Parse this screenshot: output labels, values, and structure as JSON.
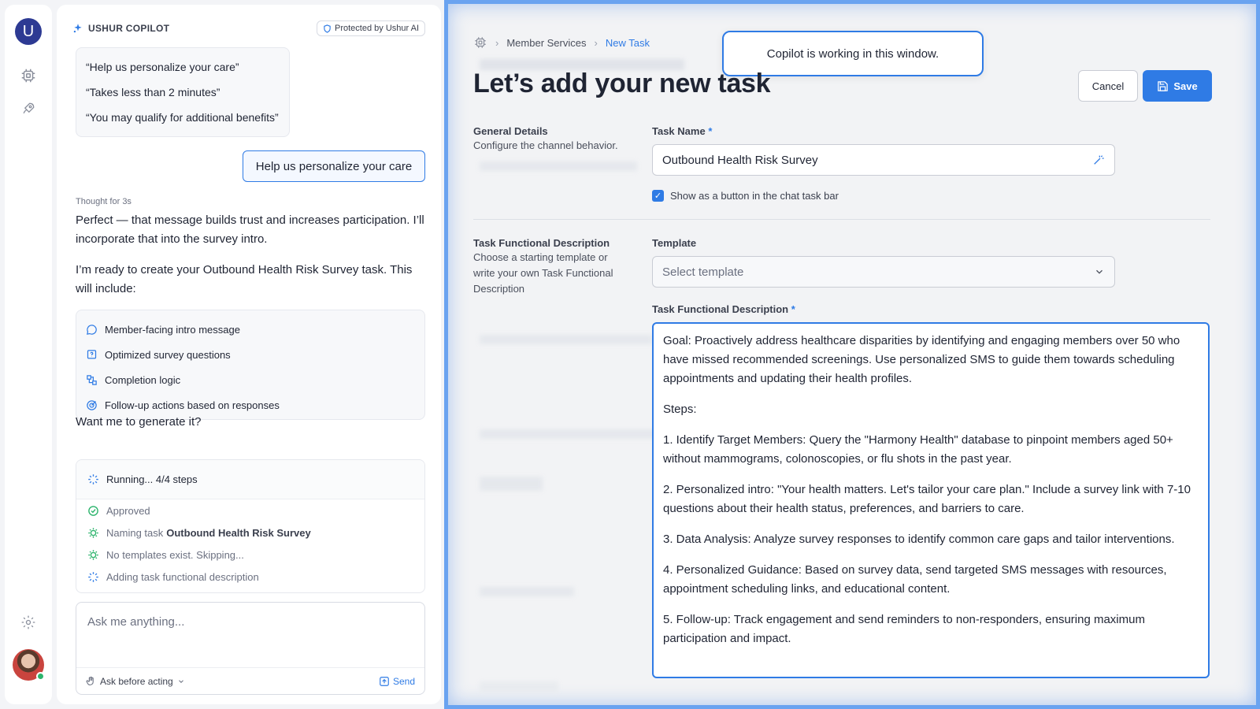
{
  "rail": {
    "logo_letter": "U",
    "items": [
      {
        "icon": "chip-icon"
      },
      {
        "icon": "rocket-icon"
      },
      {
        "icon": "gear-icon"
      }
    ]
  },
  "copilot": {
    "title": "USHUR COPILOT",
    "protected_label": "Protected by Ushur AI",
    "suggestions": [
      "“Help us personalize your care”",
      "“Takes less than 2 minutes”",
      "“You may qualify for additional benefits”"
    ],
    "user_message": "Help us personalize your care",
    "thought_label": "Thought for 3s",
    "reply_1": "Perfect — that message builds trust and increases participation. I’ll incorporate that into the survey intro.",
    "reply_2": "I’m ready to create your Outbound Health Risk Survey task. This will include:",
    "includes": [
      {
        "icon": "chat-bubble-icon",
        "label": "Member-facing intro message"
      },
      {
        "icon": "survey-icon",
        "label": "Optimized survey questions"
      },
      {
        "icon": "logic-icon",
        "label": "Completion logic"
      },
      {
        "icon": "target-icon",
        "label": "Follow-up actions based on responses"
      }
    ],
    "question": "Want me to generate it?",
    "running_label": "Running... 4/4 steps",
    "steps": [
      {
        "icon": "approved-icon",
        "text": "Approved",
        "bold": ""
      },
      {
        "icon": "gear-check-icon",
        "text": "Naming task",
        "bold": "Outbound Health Risk Survey"
      },
      {
        "icon": "gear-check-icon",
        "text": "No templates exist. Skipping...",
        "bold": ""
      },
      {
        "icon": "spinner-icon",
        "text": "Adding task functional description",
        "bold": ""
      }
    ],
    "input_placeholder": "Ask me anything...",
    "ask_mode": "Ask before acting",
    "send_label": "Send"
  },
  "main": {
    "breadcrumbs": [
      "Member Services",
      "New Task"
    ],
    "toast": "Copilot is working in this window.",
    "title": "Let’s add your new task",
    "cancel_label": "Cancel",
    "save_label": "Save",
    "general": {
      "title": "General Details",
      "desc": "Configure the channel behavior."
    },
    "task_name_label": "Task Name",
    "required_mark": "*",
    "task_name_value": "Outbound Health Risk Survey",
    "checkbox_label": "Show as a button in the chat task bar",
    "checkbox_checked": true,
    "functional": {
      "title": "Task Functional Description",
      "desc": "Choose a starting template or write your own Task Functional Description"
    },
    "template_label": "Template",
    "template_placeholder": "Select template",
    "description_label": "Task Functional Description",
    "description_paragraphs": [
      "Goal: Proactively address healthcare disparities by identifying and engaging members over 50 who have missed recommended screenings. Use personalized SMS to guide them towards scheduling appointments and updating their health profiles.",
      "Steps:",
      "1. Identify Target Members: Query the \"Harmony Health\" database to pinpoint members aged 50+ without mammograms, colonoscopies, or flu shots in the past year.",
      "2. Personalized intro: \"Your health matters. Let's tailor your care plan.\" Include a survey link with 7-10 questions about their health status, preferences, and barriers to care.",
      "3. Data Analysis: Analyze survey responses to identify common care gaps and tailor interventions.",
      "4. Personalized Guidance: Based on survey data, send targeted SMS messages with resources, appointment scheduling links, and educational content.",
      "5. Follow-up: Track engagement and send reminders to non-responders, ensuring maximum participation and impact."
    ],
    "accent_color": "#2f7be5"
  }
}
